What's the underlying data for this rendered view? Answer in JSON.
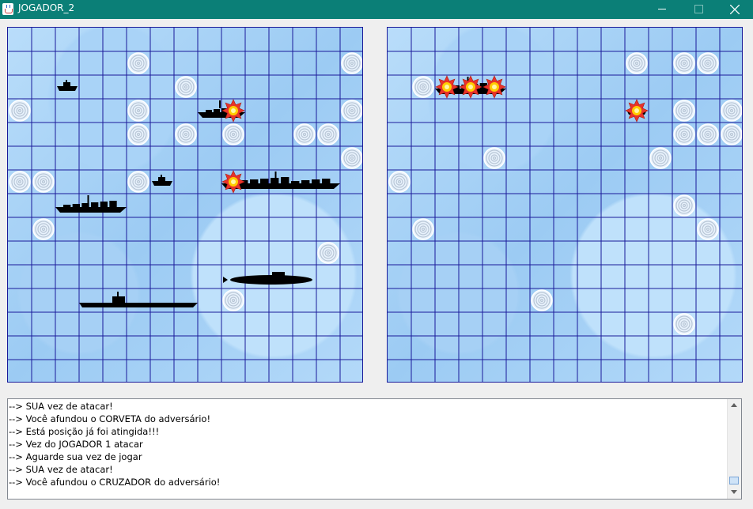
{
  "window": {
    "title": "JOGADOR_2",
    "icon": "java-cup-icon"
  },
  "colors": {
    "titlebar": "#0b7f77",
    "gridline": "#1a1a9a",
    "hit": "#ffcc00",
    "miss": "#ffffff",
    "ship": "#000000"
  },
  "boards": [
    {
      "id": "own",
      "size": 15,
      "ships": [
        {
          "type": "small-boat",
          "row": 2,
          "col": 2,
          "len": 1
        },
        {
          "type": "frigate",
          "row": 3,
          "col": 8,
          "len": 2
        },
        {
          "type": "small-boat",
          "row": 6,
          "col": 6,
          "len": 1
        },
        {
          "type": "cruiser",
          "row": 6,
          "col": 9,
          "len": 5
        },
        {
          "type": "warship",
          "row": 7,
          "col": 2,
          "len": 3
        },
        {
          "type": "submarine",
          "row": 10,
          "col": 9,
          "len": 4
        },
        {
          "type": "carrier",
          "row": 11,
          "col": 3,
          "len": 5
        }
      ],
      "misses": [
        [
          1,
          5
        ],
        [
          1,
          14
        ],
        [
          2,
          7
        ],
        [
          3,
          0
        ],
        [
          3,
          5
        ],
        [
          3,
          14
        ],
        [
          4,
          5
        ],
        [
          4,
          7
        ],
        [
          4,
          9
        ],
        [
          4,
          12
        ],
        [
          4,
          13
        ],
        [
          5,
          14
        ],
        [
          6,
          0
        ],
        [
          6,
          1
        ],
        [
          6,
          5
        ],
        [
          8,
          1
        ],
        [
          9,
          13
        ],
        [
          11,
          9
        ]
      ],
      "hits": [
        [
          3,
          9
        ],
        [
          6,
          9
        ]
      ]
    },
    {
      "id": "enemy",
      "size": 15,
      "ships": [
        {
          "type": "frigate",
          "row": 2,
          "col": 2,
          "len": 3
        },
        {
          "type": "small-boat",
          "row": 3,
          "col": 10,
          "len": 1
        }
      ],
      "misses": [
        [
          1,
          10
        ],
        [
          1,
          12
        ],
        [
          1,
          13
        ],
        [
          2,
          1
        ],
        [
          3,
          12
        ],
        [
          3,
          14
        ],
        [
          4,
          12
        ],
        [
          4,
          13
        ],
        [
          4,
          14
        ],
        [
          5,
          4
        ],
        [
          5,
          11
        ],
        [
          6,
          0
        ],
        [
          7,
          12
        ],
        [
          8,
          1
        ],
        [
          8,
          13
        ],
        [
          11,
          6
        ],
        [
          12,
          12
        ]
      ],
      "hits": [
        [
          2,
          2
        ],
        [
          2,
          3
        ],
        [
          2,
          4
        ],
        [
          3,
          10
        ]
      ]
    }
  ],
  "log": {
    "lines": [
      "--> SUA vez de atacar!",
      "--> Você afundou o CORVETA do adversário!",
      "--> Está posição já foi atingida!!!",
      "--> Vez do JOGADOR 1 atacar",
      "--> Aguarde sua vez de jogar",
      "--> SUA vez de atacar!",
      "--> Você afundou o CRUZADOR do adversário!"
    ]
  }
}
